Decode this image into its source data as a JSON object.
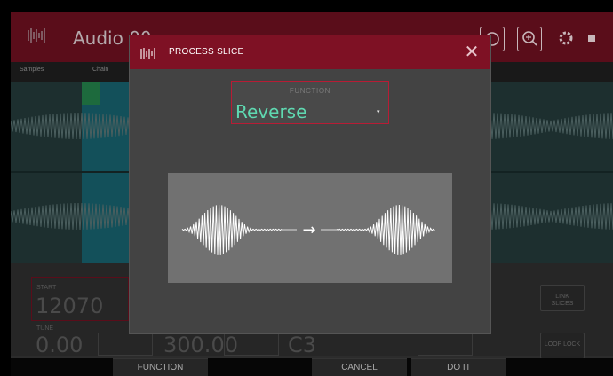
{
  "app": {
    "title": "Audio 00",
    "track_labels": [
      "Samples",
      "Chain"
    ]
  },
  "params": {
    "start_label": "START",
    "start_value": "12070",
    "tune_label": "TUNE",
    "tune_value": "0.00",
    "mid_value": "300.00",
    "note_value": "C3"
  },
  "side_buttons": {
    "link_slices": "LINK\nSLICES",
    "loop_lock": "LOOP LOCK"
  },
  "dialog": {
    "title": "PROCESS SLICE",
    "close_glyph": "✕",
    "function_label": "FUNCTION",
    "function_value": "Reverse",
    "caret_glyph": "▾",
    "arrow_glyph": "→"
  },
  "footer": {
    "function_label": "FUNCTION",
    "cancel_label": "CANCEL",
    "do_it_label": "DO IT"
  },
  "icons": [
    "waveform-logo-icon",
    "loop-icon",
    "zoom-icon",
    "gear-icon",
    "stop-icon",
    "close-icon",
    "caret-down-icon",
    "arrow-right-icon"
  ],
  "colors": {
    "accent_red": "#7e1124",
    "select_border": "#b81c35",
    "function_value": "#5fd9b1"
  }
}
